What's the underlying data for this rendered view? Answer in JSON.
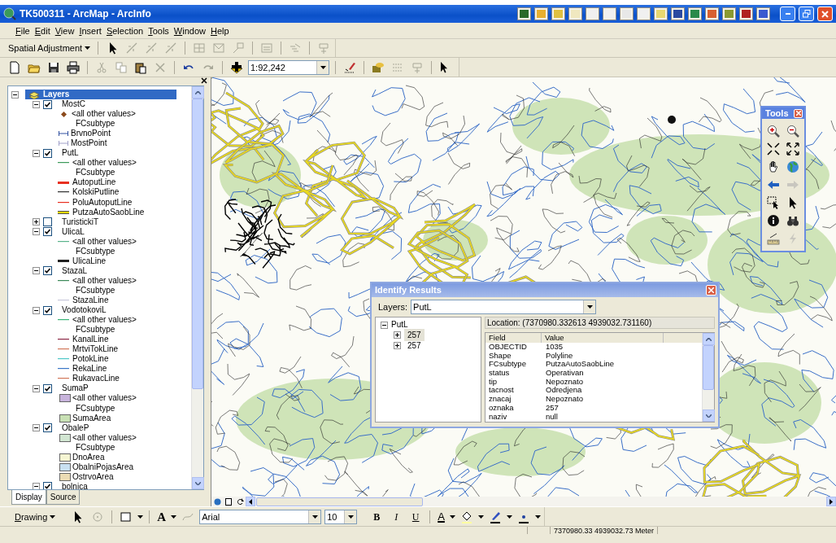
{
  "window": {
    "title": "TK500311 - ArcMap - ArcInfo"
  },
  "menu": [
    "File",
    "Edit",
    "View",
    "Insert",
    "Selection",
    "Tools",
    "Window",
    "Help"
  ],
  "spatial_adjustment": {
    "label": "Spatial Adjustment"
  },
  "standard_toolbar": {
    "scale": "1:92,242"
  },
  "toc": {
    "root": "Layers",
    "root_selected": true,
    "layers": [
      {
        "name": "MostC",
        "checked": true,
        "expanded": true,
        "legend": [
          {
            "kind": "marker",
            "label": "<all other values>",
            "color": "#8b4a1c"
          },
          {
            "kind": "heading",
            "label": "FCsubtype"
          },
          {
            "kind": "bracket",
            "label": "BrvnoPoint",
            "color": "#3050a0"
          },
          {
            "kind": "bracket",
            "label": "MostPoint",
            "color": "#a0a0c8"
          }
        ]
      },
      {
        "name": "PutL",
        "checked": true,
        "expanded": true,
        "legend": [
          {
            "kind": "line",
            "label": "<all other values>",
            "color": "#3c9a5a"
          },
          {
            "kind": "heading",
            "label": "FCsubtype"
          },
          {
            "kind": "thick-line",
            "label": "AutoputLine",
            "color": "#e83020"
          },
          {
            "kind": "line",
            "label": "KolskiPutline",
            "color": "#303030"
          },
          {
            "kind": "line",
            "label": "PoluAutoputLine",
            "color": "#e83020"
          },
          {
            "kind": "double-line",
            "label": "PutzaAutoSaobLine",
            "color": "#e8d800"
          }
        ]
      },
      {
        "name": "TuristickiT",
        "checked": false,
        "expanded": false
      },
      {
        "name": "UlicaL",
        "checked": true,
        "expanded": true,
        "legend": [
          {
            "kind": "line",
            "label": "<all other values>",
            "color": "#5ab48c"
          },
          {
            "kind": "heading",
            "label": "FCsubtype"
          },
          {
            "kind": "thick-line",
            "label": "UlicaLine",
            "color": "#202020"
          }
        ]
      },
      {
        "name": "StazaL",
        "checked": true,
        "expanded": true,
        "legend": [
          {
            "kind": "line",
            "label": "<all other values>",
            "color": "#3c8a5a"
          },
          {
            "kind": "heading",
            "label": "FCsubtype"
          },
          {
            "kind": "line",
            "label": "StazaLine",
            "color": "#c8c8dc"
          }
        ]
      },
      {
        "name": "VodotokoviL",
        "checked": true,
        "expanded": true,
        "legend": [
          {
            "kind": "line",
            "label": "<all other values>",
            "color": "#3cb478"
          },
          {
            "kind": "heading",
            "label": "FCsubtype"
          },
          {
            "kind": "line",
            "label": "KanalLine",
            "color": "#8c2846"
          },
          {
            "kind": "line",
            "label": "MrtviTokLine",
            "color": "#d2785a"
          },
          {
            "kind": "line",
            "label": "PotokLine",
            "color": "#50c8c8"
          },
          {
            "kind": "line",
            "label": "RekaLine",
            "color": "#3c78c8"
          },
          {
            "kind": "line",
            "label": "RukavacLine",
            "color": "#d2785a"
          }
        ]
      },
      {
        "name": "SumaP",
        "checked": true,
        "expanded": true,
        "legend": [
          {
            "kind": "fill",
            "label": "<all other values>",
            "color": "#c8b4dc"
          },
          {
            "kind": "heading",
            "label": "FCsubtype"
          },
          {
            "kind": "fill",
            "label": "SumaArea",
            "color": "#c8e0b4"
          }
        ]
      },
      {
        "name": "ObaleP",
        "checked": true,
        "expanded": true,
        "legend": [
          {
            "kind": "fill",
            "label": "<all other values>",
            "color": "#d2e6d2"
          },
          {
            "kind": "heading",
            "label": "FCsubtype"
          },
          {
            "kind": "fill",
            "label": "DnoArea",
            "color": "#f5f5d2"
          },
          {
            "kind": "fill",
            "label": "ObalniPojasArea",
            "color": "#c8e0f0"
          },
          {
            "kind": "fill",
            "label": "OstrvoArea",
            "color": "#ebdcb4"
          }
        ]
      },
      {
        "name": "bolnica",
        "checked": true,
        "expanded": true
      }
    ],
    "tabs": [
      {
        "label": "Display",
        "selected": true
      },
      {
        "label": "Source",
        "selected": false
      }
    ]
  },
  "identify": {
    "title": "Identify Results",
    "layers_label": "Layers:",
    "layers_value": "PutL",
    "tree": {
      "label": "PutL",
      "expanded": true,
      "children": [
        {
          "label": "257",
          "selected": true,
          "expanded": false
        },
        {
          "label": "257",
          "selected": false,
          "expanded": false
        }
      ]
    },
    "location": "Location: (7370980.332613 4939032.731160)",
    "columns": [
      "Field",
      "Value"
    ],
    "rows": [
      [
        "OBJECTID",
        "1035"
      ],
      [
        "Shape",
        "Polyline"
      ],
      [
        "FCsubtype",
        "PutzaAutoSaobLine"
      ],
      [
        "status",
        "Operativan"
      ],
      [
        "tip",
        "Nepoznato"
      ],
      [
        "tacnost",
        "Odredjena"
      ],
      [
        "znacaj",
        "Nepoznato"
      ],
      [
        "oznaka",
        "257"
      ],
      [
        "naziv",
        "null"
      ]
    ]
  },
  "tools": {
    "title": "Tools",
    "buttons": [
      {
        "kind": "zoom-in",
        "disabled": false
      },
      {
        "kind": "zoom-out",
        "disabled": false
      },
      {
        "kind": "fixed-zoom-in",
        "disabled": false
      },
      {
        "kind": "fixed-zoom-out",
        "disabled": false
      },
      {
        "kind": "pan",
        "disabled": false
      },
      {
        "kind": "globe",
        "disabled": false
      },
      {
        "kind": "back",
        "disabled": false
      },
      {
        "kind": "forward",
        "disabled": true
      },
      {
        "kind": "select-elements",
        "disabled": false
      },
      {
        "kind": "pointer",
        "disabled": false
      },
      {
        "kind": "identify",
        "disabled": false
      },
      {
        "kind": "find",
        "disabled": false
      },
      {
        "kind": "measure",
        "disabled": false
      },
      {
        "kind": "lightning",
        "disabled": true
      }
    ]
  },
  "drawing_toolbar": {
    "label": "Drawing",
    "text_tool": "A",
    "font": "Arial",
    "size": "10",
    "format_buttons": [
      "B",
      "I",
      "U"
    ],
    "font_color": "A"
  },
  "status_bar": {
    "coordinates": "7370980.33  4939032.73 Meter"
  }
}
